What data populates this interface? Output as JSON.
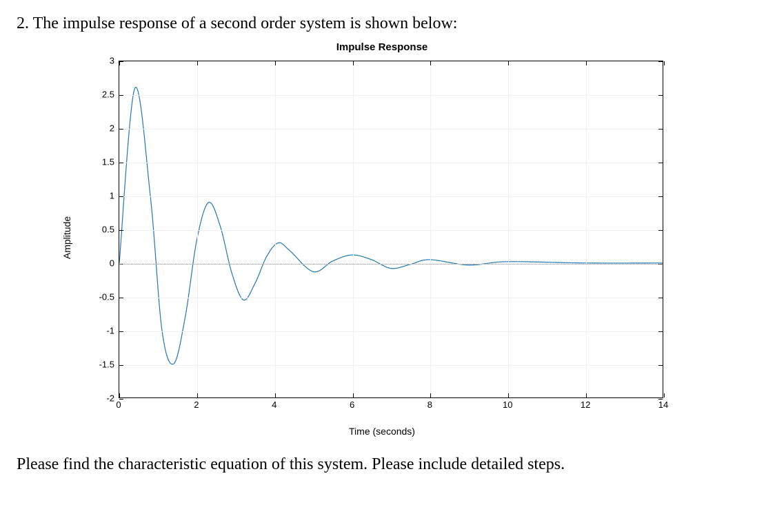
{
  "question_number": "2.",
  "question_text": "2. The impulse response of a second order system is shown below:",
  "footer_text": "Please find the characteristic equation of this system. Please include detailed steps.",
  "chart_data": {
    "type": "line",
    "title": "Impulse Response",
    "xlabel": "Time (seconds)",
    "ylabel": "Amplitude",
    "xlim": [
      0,
      14
    ],
    "ylim": [
      -2,
      3
    ],
    "x_ticks": [
      0,
      2,
      4,
      6,
      8,
      10,
      12,
      14
    ],
    "y_ticks": [
      -2,
      -1.5,
      -1,
      -0.5,
      0,
      0.5,
      1,
      1.5,
      2,
      2.5,
      3
    ],
    "x": [
      0,
      0.4,
      0.8,
      1.1,
      1.4,
      1.7,
      2.0,
      2.3,
      2.6,
      2.9,
      3.2,
      3.5,
      3.8,
      4.1,
      4.4,
      5.0,
      5.5,
      6.0,
      6.5,
      7.0,
      7.5,
      8.0,
      9.0,
      10.0,
      12.0,
      14.0
    ],
    "values": [
      0,
      2.6,
      1.0,
      -1.0,
      -1.5,
      -0.8,
      0.35,
      0.9,
      0.55,
      -0.15,
      -0.55,
      -0.3,
      0.1,
      0.3,
      0.18,
      -0.13,
      0.03,
      0.12,
      0.05,
      -0.08,
      -0.02,
      0.05,
      -0.03,
      0.02,
      0.0,
      0.0
    ],
    "zero_reference": 0
  }
}
